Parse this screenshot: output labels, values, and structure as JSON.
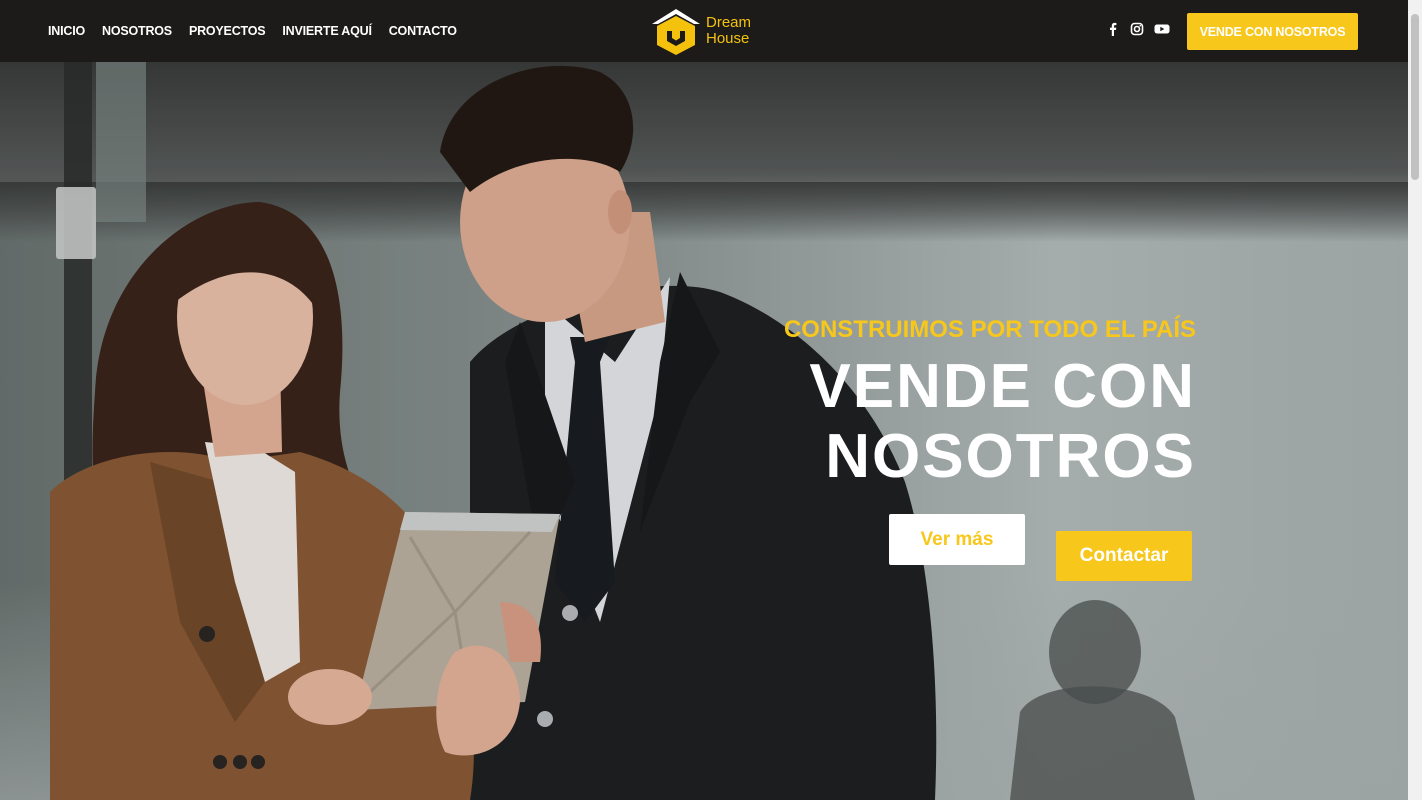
{
  "header": {
    "nav": [
      {
        "label": "INICIO"
      },
      {
        "label": "NOSOTROS"
      },
      {
        "label": "PROYECTOS"
      },
      {
        "label": "INVIERTE AQUÍ"
      },
      {
        "label": "CONTACTO"
      }
    ],
    "logo": {
      "line1": "Dream",
      "line2": "House"
    },
    "social_icons": [
      "facebook-icon",
      "instagram-icon",
      "youtube-icon"
    ],
    "cta_label": "VENDE CON NOSOTROS"
  },
  "hero": {
    "subtitle": "CONSTRUIMOS POR TODO EL PAÍS",
    "title_line1": "VENDE CON",
    "title_line2": "NOSOTROS",
    "buttons": {
      "primary": "Ver más",
      "secondary": "Contactar"
    }
  },
  "colors": {
    "accent": "#f7c71b",
    "header_bg": "#1c1b1a",
    "white": "#ffffff"
  }
}
